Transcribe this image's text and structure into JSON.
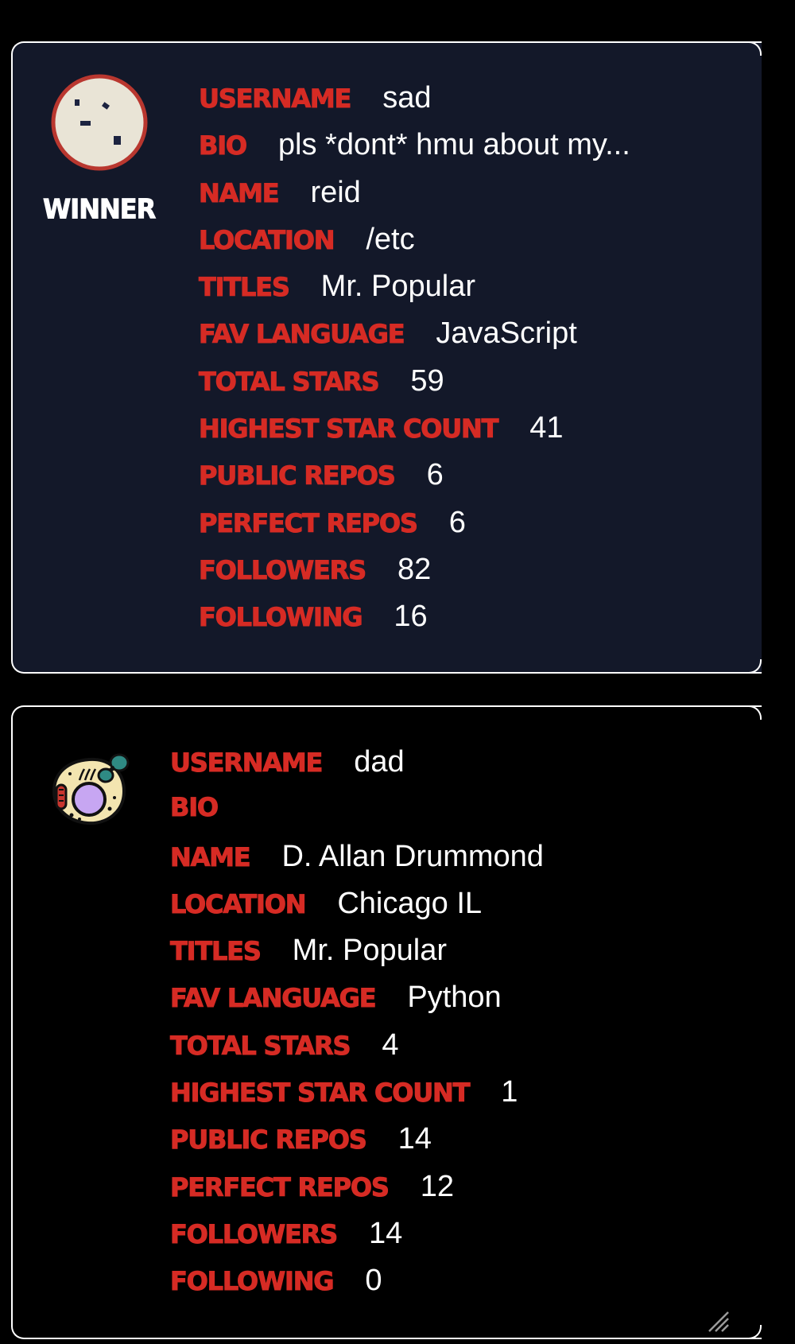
{
  "profiles": [
    {
      "badge": "WINNER",
      "avatar_icon": "dotted-cookie-avatar",
      "fields": [
        {
          "label": "USERNAME",
          "value": "sad"
        },
        {
          "label": "BIO",
          "value": "pls *dont* hmu about my..."
        },
        {
          "label": "NAME",
          "value": "reid"
        },
        {
          "label": "LOCATION",
          "value": "/etc"
        },
        {
          "label": "TITLES",
          "value": "Mr. Popular"
        },
        {
          "label": "FAV LANGUAGE",
          "value": "JavaScript"
        },
        {
          "label": "TOTAL STARS",
          "value": "59"
        },
        {
          "label": "HIGHEST STAR COUNT",
          "value": "41"
        },
        {
          "label": "PUBLIC REPOS",
          "value": "6"
        },
        {
          "label": "PERFECT REPOS",
          "value": "6"
        },
        {
          "label": "FOLLOWERS",
          "value": "82"
        },
        {
          "label": "FOLLOWING",
          "value": "16"
        }
      ]
    },
    {
      "badge": "",
      "avatar_icon": "cell-avatar",
      "fields": [
        {
          "label": "USERNAME",
          "value": "dad"
        },
        {
          "label": "BIO",
          "value": ""
        },
        {
          "label": "NAME",
          "value": "D. Allan Drummond"
        },
        {
          "label": "LOCATION",
          "value": "Chicago IL"
        },
        {
          "label": "TITLES",
          "value": "Mr. Popular"
        },
        {
          "label": "FAV LANGUAGE",
          "value": "Python"
        },
        {
          "label": "TOTAL STARS",
          "value": "4"
        },
        {
          "label": "HIGHEST STAR COUNT",
          "value": "1"
        },
        {
          "label": "PUBLIC REPOS",
          "value": "14"
        },
        {
          "label": "PERFECT REPOS",
          "value": "12"
        },
        {
          "label": "FOLLOWERS",
          "value": "14"
        },
        {
          "label": "FOLLOWING",
          "value": "0"
        }
      ]
    }
  ],
  "colors": {
    "label_red": "#d62b24",
    "winner_card_bg": "#131829",
    "page_bg": "#000000",
    "text_white": "#ffffff"
  }
}
